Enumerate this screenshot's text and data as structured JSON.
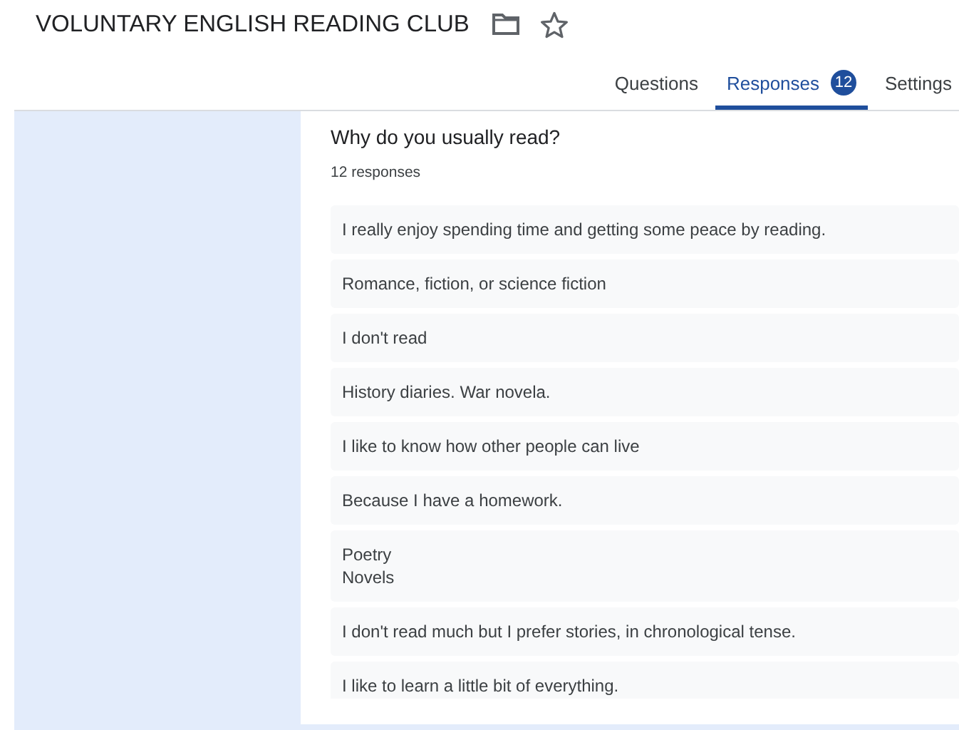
{
  "form": {
    "title": "VOLUNTARY ENGLISH READING CLUB"
  },
  "tabs": [
    {
      "label": "Questions",
      "selected": false
    },
    {
      "label": "Responses",
      "selected": true,
      "badge": "12"
    },
    {
      "label": "Settings",
      "selected": false
    }
  ],
  "question": {
    "title": "Why do you usually read?",
    "count": "12 responses"
  },
  "responses": [
    "I really enjoy spending time and getting some peace by reading.",
    "Romance, fiction, or science fiction",
    "I don't read",
    "History diaries. War novela.",
    "I like to know how other people can live",
    "Because I have a homework.",
    "Poetry\nNovels",
    "I don't read much but I prefer stories, in chronological tense.",
    "I like to learn a little bit of everything."
  ]
}
